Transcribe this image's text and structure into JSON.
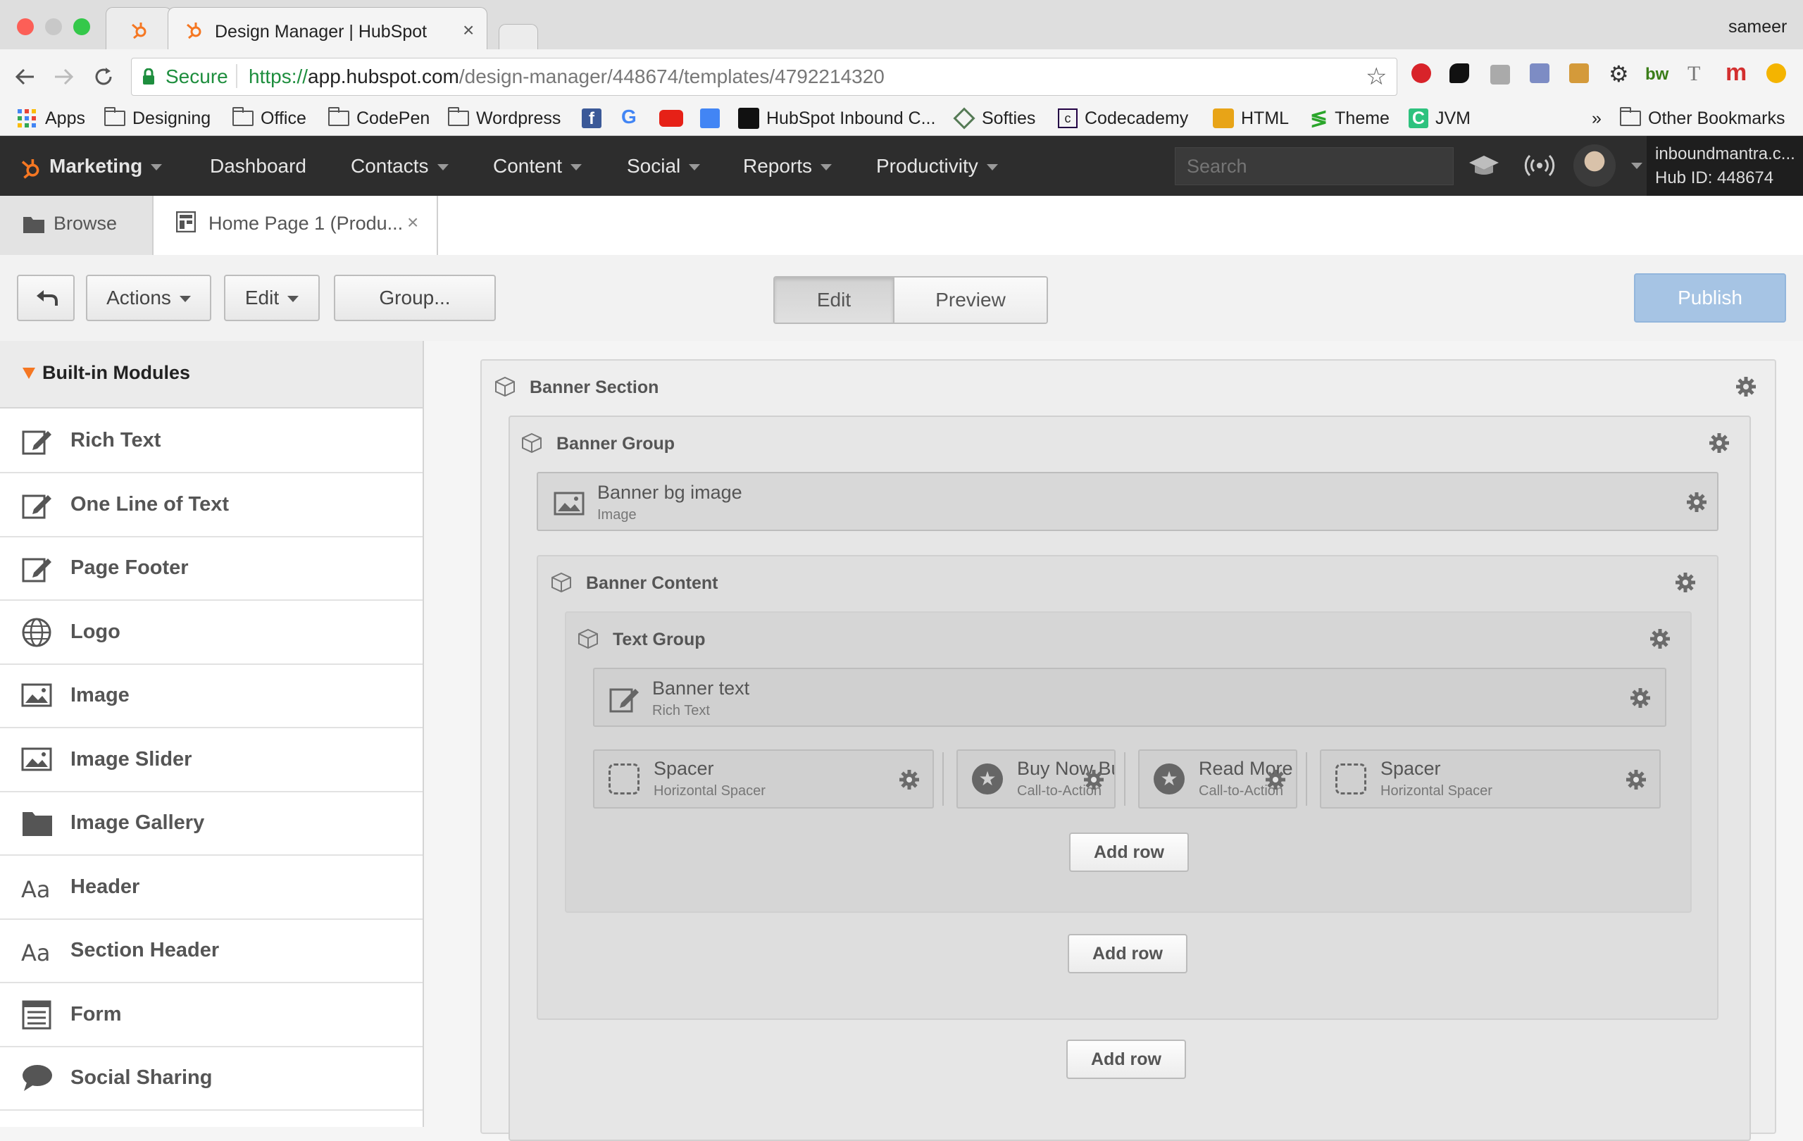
{
  "browser": {
    "tab_title": "Design Manager | HubSpot",
    "profile_name": "sameer",
    "security_label": "Secure",
    "url_scheme": "https://",
    "url_host": "app.hubspot.com",
    "url_path": "/design-manager/448674/templates/4792214320",
    "bookmarks": [
      "Apps",
      "Designing",
      "Office",
      "CodePen",
      "Wordpress",
      "HubSpot Inbound C...",
      "Softies",
      "Codecademy",
      "HTML",
      "Theme",
      "JVM"
    ],
    "bookmarks_overflow": "»",
    "other_bookmarks": "Other Bookmarks"
  },
  "hubspot_nav": {
    "brand": "Marketing",
    "items": [
      "Dashboard",
      "Contacts",
      "Content",
      "Social",
      "Reports",
      "Productivity"
    ],
    "search_placeholder": "Search",
    "account_name": "inboundmantra.c...",
    "hub_id": "Hub ID: 448674"
  },
  "file_tabs": {
    "browse": "Browse",
    "open_file": "Home Page 1 (Produ...",
    "close": "×"
  },
  "toolbar": {
    "actions": "Actions",
    "edit_menu": "Edit",
    "group": "Group...",
    "mode_edit": "Edit",
    "mode_preview": "Preview",
    "publish": "Publish",
    "accent": "#ff7a59",
    "publish_color": "#a6c4e4"
  },
  "sidebar": {
    "heading": "Built-in Modules",
    "items": [
      {
        "label": "Rich Text",
        "icon": "edit-icon"
      },
      {
        "label": "One Line of Text",
        "icon": "edit-icon"
      },
      {
        "label": "Page Footer",
        "icon": "edit-icon"
      },
      {
        "label": "Logo",
        "icon": "globe-icon"
      },
      {
        "label": "Image",
        "icon": "image-icon"
      },
      {
        "label": "Image Slider",
        "icon": "image-icon"
      },
      {
        "label": "Image Gallery",
        "icon": "folder-icon"
      },
      {
        "label": "Header",
        "icon": "text-aa-icon"
      },
      {
        "label": "Section Header",
        "icon": "text-aa-icon"
      },
      {
        "label": "Form",
        "icon": "form-icon"
      },
      {
        "label": "Social Sharing",
        "icon": "speech-bubble-icon"
      }
    ]
  },
  "layout": {
    "banner_section": "Banner Section",
    "banner_group": "Banner Group",
    "banner_bg_image": {
      "title": "Banner bg image",
      "type": "Image"
    },
    "banner_content": "Banner Content",
    "text_group": "Text Group",
    "banner_text": {
      "title": "Banner text",
      "type": "Rich Text"
    },
    "row_modules": [
      {
        "title": "Spacer",
        "type": "Horizontal Spacer"
      },
      {
        "title": "Buy Now Bu",
        "type": "Call-to-Action"
      },
      {
        "title": "Read More E",
        "type": "Call-to-Action"
      },
      {
        "title": "Spacer",
        "type": "Horizontal Spacer"
      }
    ],
    "add_row": "Add row"
  }
}
